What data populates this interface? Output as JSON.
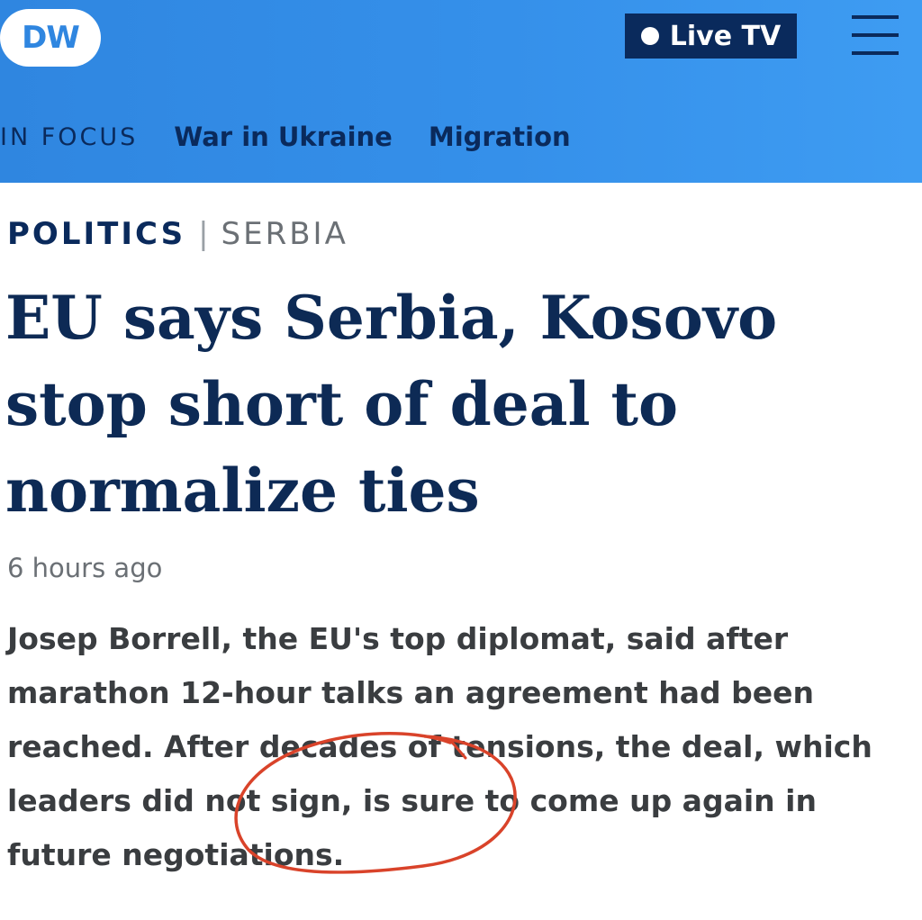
{
  "header": {
    "logo_text": "DW",
    "live_label": "Live TV",
    "nav_label": "IN FOCUS",
    "nav_items": [
      "War in Ukraine",
      "Migration"
    ]
  },
  "article": {
    "category": "POLITICS",
    "subcategory": "SERBIA",
    "title": "EU says Serbia, Kosovo stop short of deal to normalize ties",
    "timestamp": "6 hours ago",
    "teaser": "Josep Borrell, the EU's top diplomat, said after marathon 12-hour talks an agreement had been reached. After decades of tensions, the deal, which leaders did not sign, is sure to come up again in future negotiations."
  },
  "colors": {
    "header_blue": "#3590ea",
    "navy": "#0a2a5c",
    "annotation_red": "#d9432a"
  }
}
